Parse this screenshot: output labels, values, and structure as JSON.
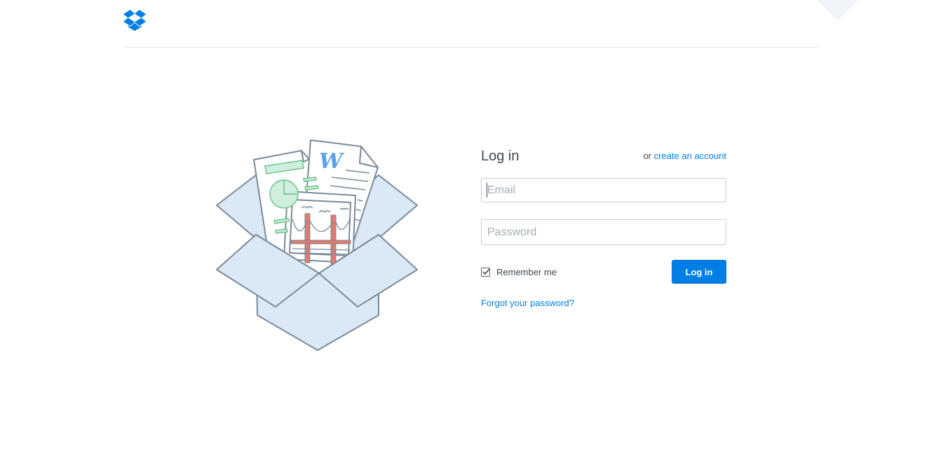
{
  "header": {
    "logo_icon": "dropbox-logo-icon",
    "brand_color": "#007ee5"
  },
  "illustration": {
    "icon": "open-box-with-documents-illustration",
    "doc_letter": "W"
  },
  "login": {
    "title": "Log in",
    "or_text": "or",
    "create_account_label": "create an account",
    "email_placeholder": "Email",
    "email_value": "",
    "password_placeholder": "Password",
    "password_value": "",
    "remember_label": "Remember me",
    "remember_checked": true,
    "submit_label": "Log in",
    "forgot_label": "Forgot your password?"
  },
  "colors": {
    "accent": "#007ee5",
    "text": "#3d464d",
    "border": "#c5ced6"
  }
}
